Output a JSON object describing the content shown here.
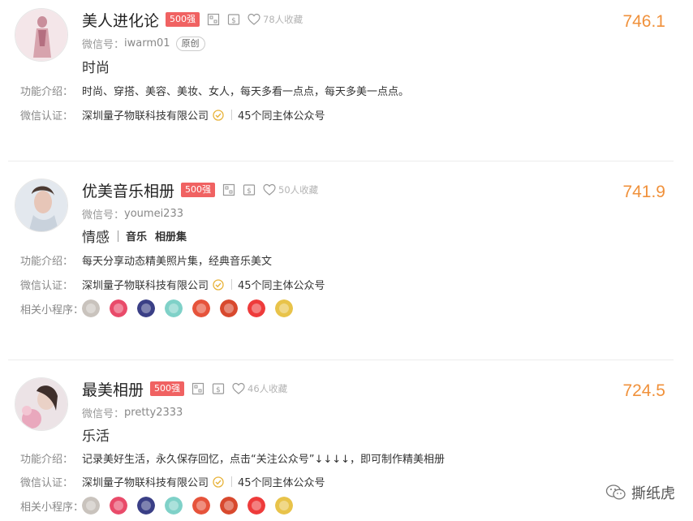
{
  "accounts": [
    {
      "name": "美人进化论",
      "badge": "500强",
      "favorites": "78人收藏",
      "score": "746.1",
      "wechat_label": "微信号：",
      "wechat_id": "iwarm01",
      "original_tag": "原创",
      "category": "时尚",
      "tags": [],
      "intro_label": "功能介绍：",
      "intro": "时尚、穿搭、美容、美妆、女人，每天多看一点点，每天多美一点点。",
      "verify_label": "微信认证：",
      "company": "深圳量子物联科技有限公司",
      "same_subject": "45个同主体公众号",
      "mini_label": "",
      "avatar_color": "#f2dfe3"
    },
    {
      "name": "优美音乐相册",
      "badge": "500强",
      "favorites": "50人收藏",
      "score": "741.9",
      "wechat_label": "微信号：",
      "wechat_id": "youmei233",
      "original_tag": "",
      "category": "情感",
      "tags": [
        "音乐",
        "相册集"
      ],
      "intro_label": "功能介绍：",
      "intro": "每天分享动态精美照片集，经典音乐美文",
      "verify_label": "微信认证：",
      "company": "深圳量子物联科技有限公司",
      "same_subject": "45个同主体公众号",
      "mini_label": "相关小程序：",
      "avatar_color": "#dfe6ec"
    },
    {
      "name": "最美相册",
      "badge": "500强",
      "favorites": "46人收藏",
      "score": "724.5",
      "wechat_label": "微信号：",
      "wechat_id": "pretty2333",
      "original_tag": "",
      "category": "乐活",
      "tags": [],
      "intro_label": "功能介绍：",
      "intro": "记录美好生活，永久保存回忆，点击“关注公众号”↓↓↓↓，即可制作精美相册",
      "verify_label": "微信认证：",
      "company": "深圳量子物联科技有限公司",
      "same_subject": "45个同主体公众号",
      "mini_label": "相关小程序：",
      "avatar_color": "#e7d9df"
    }
  ],
  "mini_program_colors": [
    "#c9c3bd",
    "#e94b6a",
    "#3a3f86",
    "#7fd1c8",
    "#e6533b",
    "#d8492e",
    "#ee3b3b",
    "#e8c34a"
  ],
  "colors": {
    "accent": "#f0913b",
    "badge": "#f06262",
    "verify": "#e8b33a"
  },
  "watermark": "撕纸虎"
}
